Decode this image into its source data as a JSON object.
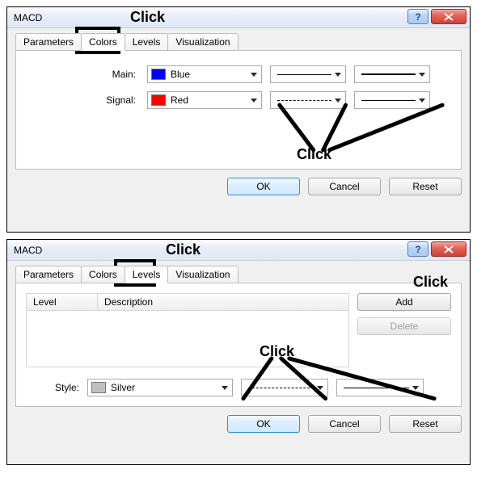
{
  "dialog1": {
    "title": "MACD",
    "tabs": [
      "Parameters",
      "Colors",
      "Levels",
      "Visualization"
    ],
    "active_tab": "Colors",
    "rows": {
      "main": {
        "label": "Main:",
        "color_name": "Blue"
      },
      "signal": {
        "label": "Signal:",
        "color_name": "Red"
      }
    },
    "buttons": {
      "ok": "OK",
      "cancel": "Cancel",
      "reset": "Reset"
    }
  },
  "dialog2": {
    "title": "MACD",
    "tabs": [
      "Parameters",
      "Colors",
      "Levels",
      "Visualization"
    ],
    "active_tab": "Levels",
    "table": {
      "col_level": "Level",
      "col_desc": "Description"
    },
    "side": {
      "add": "Add",
      "delete": "Delete"
    },
    "style": {
      "label": "Style:",
      "color_name": "Silver"
    },
    "buttons": {
      "ok": "OK",
      "cancel": "Cancel",
      "reset": "Reset"
    }
  },
  "annotations": {
    "click": "Click"
  }
}
